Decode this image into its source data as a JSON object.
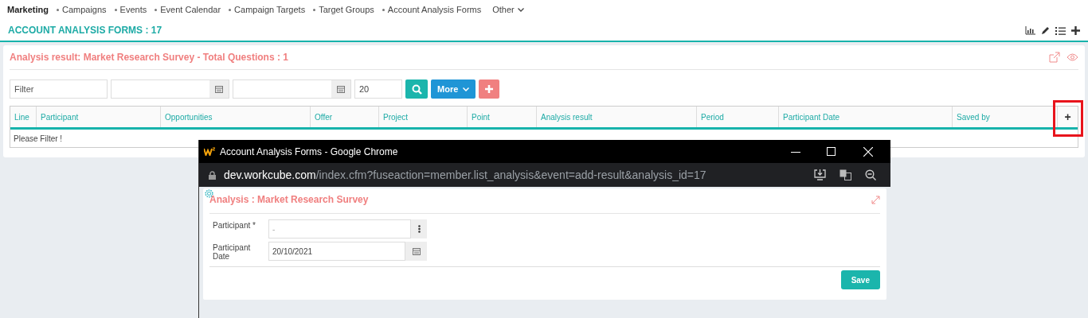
{
  "nav": {
    "items": [
      {
        "label": "Marketing",
        "selected": true
      },
      {
        "label": "Campaigns",
        "selected": false
      },
      {
        "label": "Events",
        "selected": false
      },
      {
        "label": "Event Calendar",
        "selected": false
      },
      {
        "label": "Campaign Targets",
        "selected": false
      },
      {
        "label": "Target Groups",
        "selected": false
      },
      {
        "label": "Account Analysis Forms",
        "selected": false
      }
    ],
    "more": "Other"
  },
  "header": {
    "title": "ACCOUNT ANALYSIS FORMS : 17"
  },
  "card": {
    "title": "Analysis result: Market Research Survey - Total Questions : 1",
    "filter": {
      "placeholder": "Filter",
      "page_size": "20",
      "more_button": "More"
    },
    "table": {
      "columns": [
        "Line",
        "Participant",
        "Opportunities",
        "Offer",
        "Project",
        "Point",
        "Analysis result",
        "Period",
        "Participant Date",
        "Saved by"
      ],
      "add_button": "+",
      "highlighted": true,
      "empty_message": "Please Filter !"
    }
  },
  "popup": {
    "window_title": "Account Analysis Forms - Google Chrome",
    "url_host": "dev.workcube.com",
    "url_path": "/index.cfm?fuseaction=member.list_analysis&event=add-result&analysis_id=17",
    "form_title": "Analysis : Market Research Survey",
    "fields": [
      {
        "label": "Participant *",
        "value": "-",
        "kind": "picker"
      },
      {
        "label": "Participant Date",
        "value": "20/10/2021",
        "kind": "date"
      }
    ],
    "save_button": "Save"
  }
}
